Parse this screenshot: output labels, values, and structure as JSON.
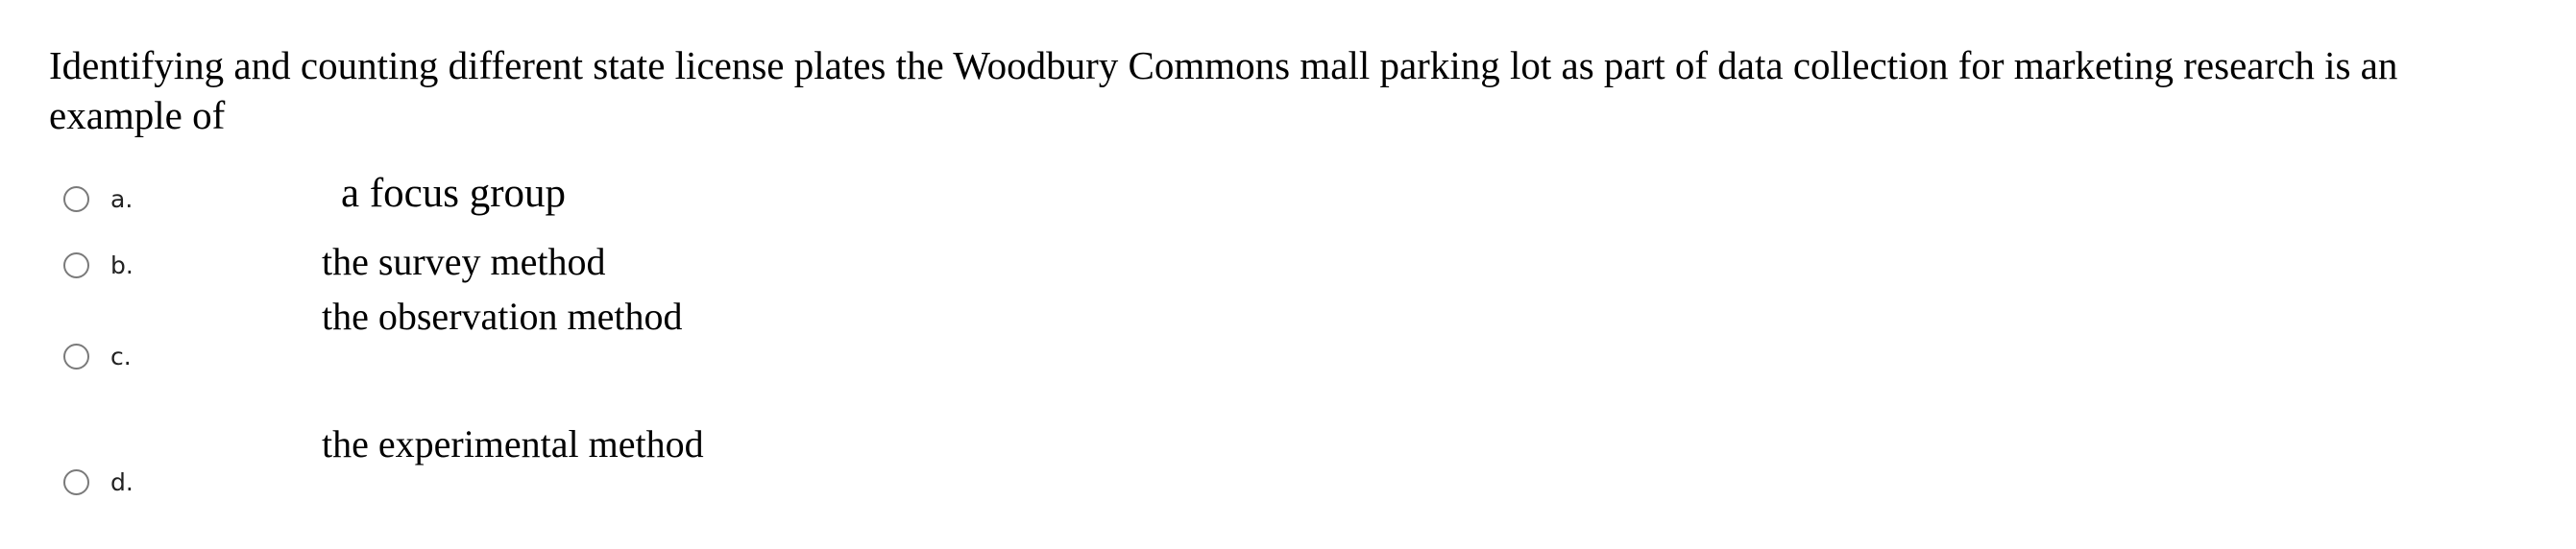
{
  "question": {
    "text": "Identifying and counting different state license plates the Woodbury Commons mall parking lot as part of data collection for marketing research is an example of"
  },
  "options": [
    {
      "letter": "a.",
      "text": "a focus group",
      "selected": false
    },
    {
      "letter": "b.",
      "text": "the survey method",
      "selected": false
    },
    {
      "letter": "c.",
      "text": "the observation method",
      "selected": false
    },
    {
      "letter": "d.",
      "text": "the experimental method",
      "selected": false
    }
  ],
  "colors": {
    "radio_border": "#7a7a7a",
    "text": "#000000",
    "label": "#222222"
  }
}
